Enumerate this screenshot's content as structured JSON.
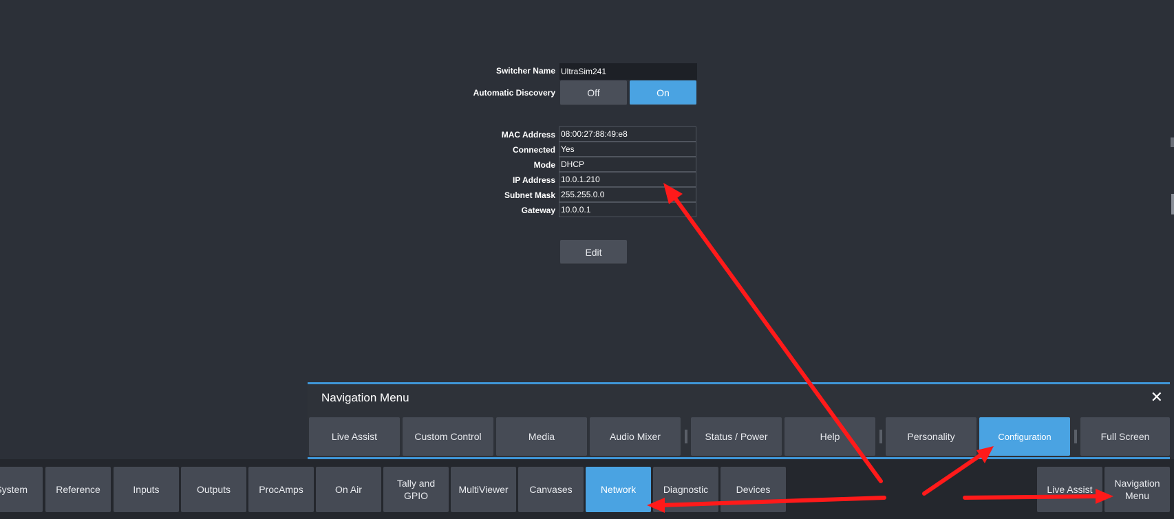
{
  "config": {
    "switcher_name_label": "Switcher Name",
    "switcher_name_value": "UltraSim241",
    "auto_discovery_label": "Automatic Discovery",
    "off_label": "Off",
    "on_label": "On",
    "auto_discovery_selected": "On"
  },
  "network": {
    "fields": [
      {
        "label": "MAC Address",
        "value": "08:00:27:88:49:e8"
      },
      {
        "label": "Connected",
        "value": "Yes"
      },
      {
        "label": "Mode",
        "value": "DHCP"
      },
      {
        "label": "IP Address",
        "value": "10.0.1.210"
      },
      {
        "label": "Subnet Mask",
        "value": "255.255.0.0"
      },
      {
        "label": "Gateway",
        "value": "10.0.0.1"
      }
    ],
    "edit_label": "Edit"
  },
  "nav_menu": {
    "title": "Navigation Menu",
    "close_glyph": "✕",
    "items": [
      {
        "label": "Live Assist"
      },
      {
        "label": "Custom Control"
      },
      {
        "label": "Media"
      },
      {
        "label": "Audio Mixer"
      },
      {
        "label": "Status / Power"
      },
      {
        "label": "Help"
      },
      {
        "label": "Personality"
      },
      {
        "label": "Configuration"
      },
      {
        "label": "Full Screen"
      }
    ],
    "active_item": "Configuration"
  },
  "bottom_tabs": {
    "items": [
      {
        "label": "System"
      },
      {
        "label": "Reference"
      },
      {
        "label": "Inputs"
      },
      {
        "label": "Outputs"
      },
      {
        "label": "ProcAmps"
      },
      {
        "label": "On Air"
      },
      {
        "label": "Tally and GPIO"
      },
      {
        "label": "MultiViewer"
      },
      {
        "label": "Canvases"
      },
      {
        "label": "Network"
      },
      {
        "label": "Diagnostic"
      },
      {
        "label": "Devices"
      }
    ],
    "active_item": "Network",
    "right_items": [
      {
        "label": "Live Assist"
      },
      {
        "label": "Navigation Menu"
      }
    ]
  },
  "colors": {
    "background": "#2c3038",
    "accent": "#4aa3e2",
    "annotation_arrow": "#ff1a1a"
  }
}
